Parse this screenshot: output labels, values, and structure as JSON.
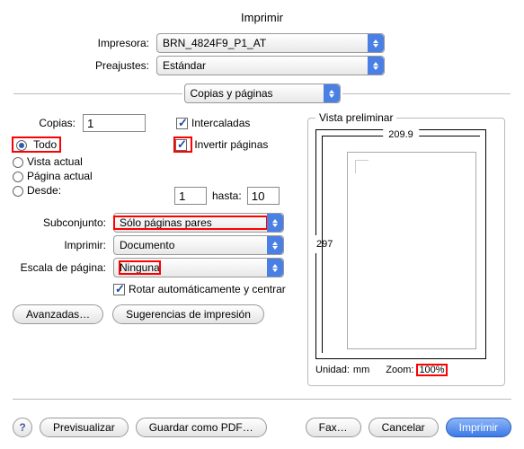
{
  "title": "Imprimir",
  "printer": {
    "label": "Impresora:",
    "value": "BRN_4824F9_P1_AT"
  },
  "presets": {
    "label": "Preajustes:",
    "value": "Estándar"
  },
  "sectionSelect": "Copias y páginas",
  "copies": {
    "label": "Copias:",
    "value": "1"
  },
  "collate": "Intercaladas",
  "reverse": "Invertir páginas",
  "range": {
    "all": "Todo",
    "current_view": "Vista actual",
    "current_page": "Página actual",
    "from_label": "Desde:",
    "from": "1",
    "to_label": "hasta:",
    "to": "10"
  },
  "subset": {
    "label": "Subconjunto:",
    "value": "Sólo páginas pares"
  },
  "printWhat": {
    "label": "Imprimir:",
    "value": "Documento"
  },
  "scale": {
    "label": "Escala de página:",
    "value": "Ninguna"
  },
  "autorotate": "Rotar automáticamente y centrar",
  "preview": {
    "legend": "Vista preliminar",
    "width": "209.9",
    "height": "297",
    "unit_label": "Unidad:",
    "unit": "mm",
    "zoom_label": "Zoom:",
    "zoom": "100%"
  },
  "buttons": {
    "advanced": "Avanzadas…",
    "hints": "Sugerencias de impresión",
    "preview": "Previsualizar",
    "savepdf": "Guardar como PDF…",
    "fax": "Fax…",
    "cancel": "Cancelar",
    "print": "Imprimir"
  }
}
